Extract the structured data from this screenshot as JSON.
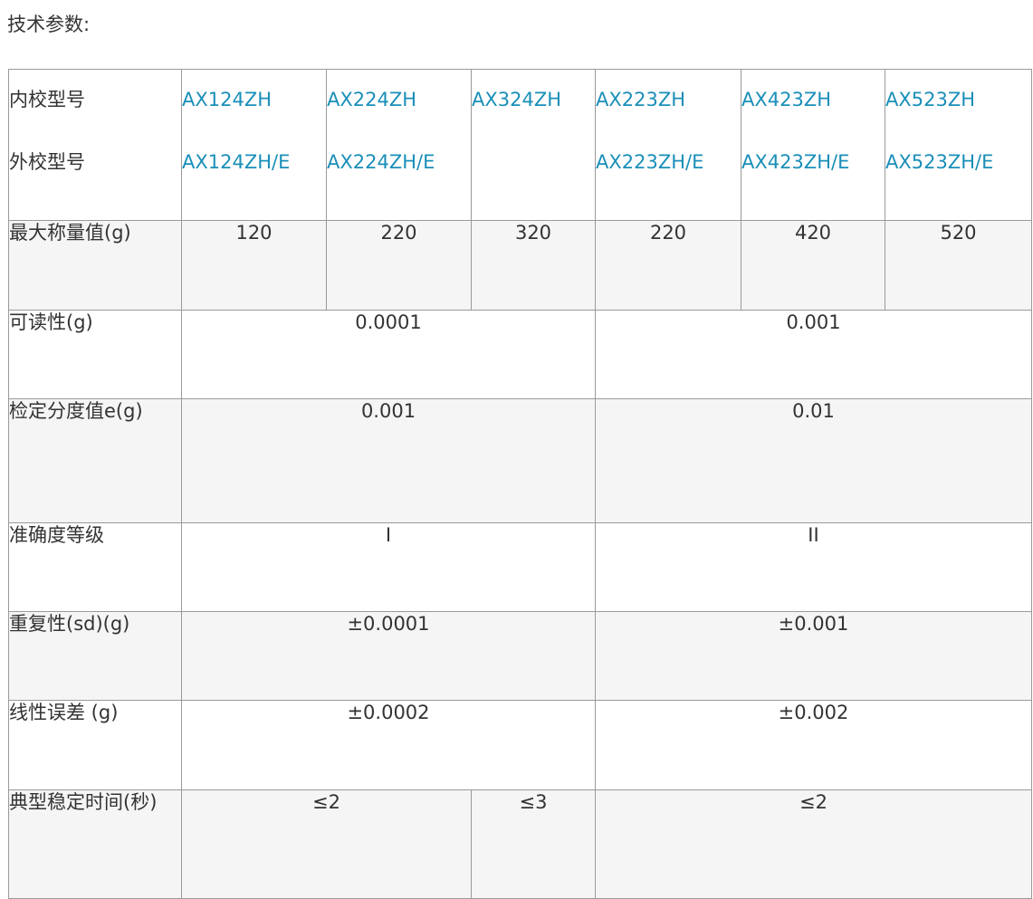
{
  "heading": "技术参数:",
  "rows": {
    "models": {
      "label_internal": "内校型号",
      "label_external": "外校型号",
      "internal": [
        "AX124ZH",
        "AX224ZH",
        "AX324ZH",
        "AX223ZH",
        "AX423ZH",
        "AX523ZH"
      ],
      "external": [
        "AX124ZH/E",
        "AX224ZH/E",
        "",
        "AX223ZH/E",
        "AX423ZH/E",
        "AX523ZH/E"
      ]
    },
    "max_capacity": {
      "label": "最大称量值(g)",
      "values": [
        "120",
        "220",
        "320",
        "220",
        "420",
        "520"
      ]
    },
    "readability": {
      "label": "可读性(g)",
      "values": [
        "0.0001",
        "0.001"
      ]
    },
    "verification_interval": {
      "label": "检定分度值e(g)",
      "values": [
        "0.001",
        "0.01"
      ]
    },
    "accuracy_class": {
      "label": "准确度等级",
      "values": [
        "I",
        "II"
      ]
    },
    "repeatability": {
      "label": "重复性(sd)(g)",
      "values": [
        "±0.0001",
        "±0.001"
      ]
    },
    "linearity": {
      "label": "线性误差 (g)",
      "values": [
        "±0.0002",
        "±0.002"
      ]
    },
    "stabilization_time": {
      "label": "典型稳定时间(秒)",
      "values": [
        "≤2",
        "≤3",
        "≤2"
      ]
    }
  },
  "colors": {
    "link": "#1a8fb8",
    "text": "#333333",
    "border": "#9a9a9a",
    "row_gray": "#f5f5f5"
  }
}
